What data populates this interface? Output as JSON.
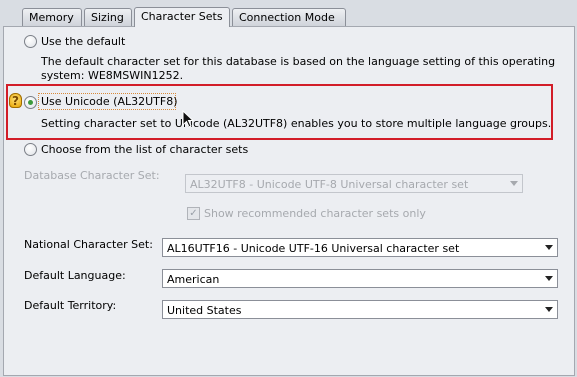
{
  "tabs": [
    {
      "label": "Memory"
    },
    {
      "label": "Sizing"
    },
    {
      "label": "Character Sets"
    },
    {
      "label": "Connection Mode"
    }
  ],
  "options": {
    "use_default": {
      "label": "Use the default",
      "description_line1": "The default character set for this database is based on the language setting of this operating",
      "description_line2": "system: WE8MSWIN1252."
    },
    "use_unicode": {
      "label": "Use Unicode (AL32UTF8)",
      "description": "Setting character set to Unicode (AL32UTF8) enables you to store multiple language groups."
    },
    "choose_list": {
      "label": "Choose from the list of character sets"
    }
  },
  "db_charset": {
    "label": "Database Character Set:",
    "value": "AL32UTF8 - Unicode UTF-8 Universal character set",
    "show_recommended_label": "Show recommended character sets only",
    "show_recommended_checked": true
  },
  "national_charset": {
    "label": "National Character Set:",
    "value": "AL16UTF16 - Unicode UTF-16 Universal character set"
  },
  "default_language": {
    "label": "Default Language:",
    "value": "American"
  },
  "default_territory": {
    "label": "Default Territory:",
    "value": "United States"
  },
  "colors": {
    "highlight_border": "#d21d28",
    "radio_selected": "#3c9a3c",
    "disabled_text": "#a6a9ae"
  },
  "icons": {
    "hint": "lightbulb-hint-icon",
    "cursor": "mouse-pointer-icon"
  },
  "selected_option": "use_unicode"
}
